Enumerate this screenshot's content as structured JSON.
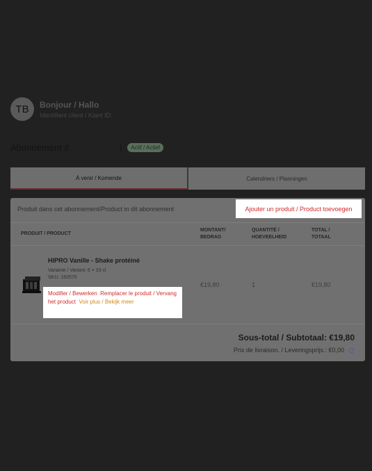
{
  "user": {
    "initials": "TB",
    "greeting": "Bonjour / Hallo",
    "customer_id_label": "Identifiant client / Klant ID:"
  },
  "subscription": {
    "title": "Abonnement #",
    "paren": ")",
    "status": "Actif / Actief"
  },
  "tabs": [
    {
      "label": "À venir / Komende",
      "active": true
    },
    {
      "label": "Calendriers / Planningen",
      "active": false
    }
  ],
  "card": {
    "heading": "Produit dans cet abonnement/Product in dit abonnement",
    "add_button": "Ajouter un produit / Product toevoegen",
    "columns": {
      "product": "PRODUIT / PRODUCT",
      "amount": "MONTANT/ BEDRAG",
      "quantity": "QUANTITÉ / HOEVEELHEID",
      "total": "TOTAL / TOTAAL"
    },
    "product": {
      "name": "HIPRO Vanille - Shake protéiné",
      "variant": "Variante / Variant: 6 × 33 cl",
      "sku": "SKU: 192570",
      "edit": "Modifier / Bewerken",
      "replace": "Remplacer le produit / Vervang het product",
      "more": "Voir plus / Bekijk meer",
      "amount": "€19,80",
      "quantity": "1",
      "total": "€19,80"
    },
    "subtotal": "Sous-total / Subtotaal: €19,80",
    "delivery": "Prix de livraison. / Leveringsprijs.: €0,00"
  },
  "colors": {
    "background": "#212121",
    "accent_red": "#d32a2a",
    "accent_orange": "#d28b16",
    "badge": "#5b6d5c"
  },
  "icons": {
    "product_thumbnail": "product-box-icon",
    "refresh": "refresh-icon"
  }
}
